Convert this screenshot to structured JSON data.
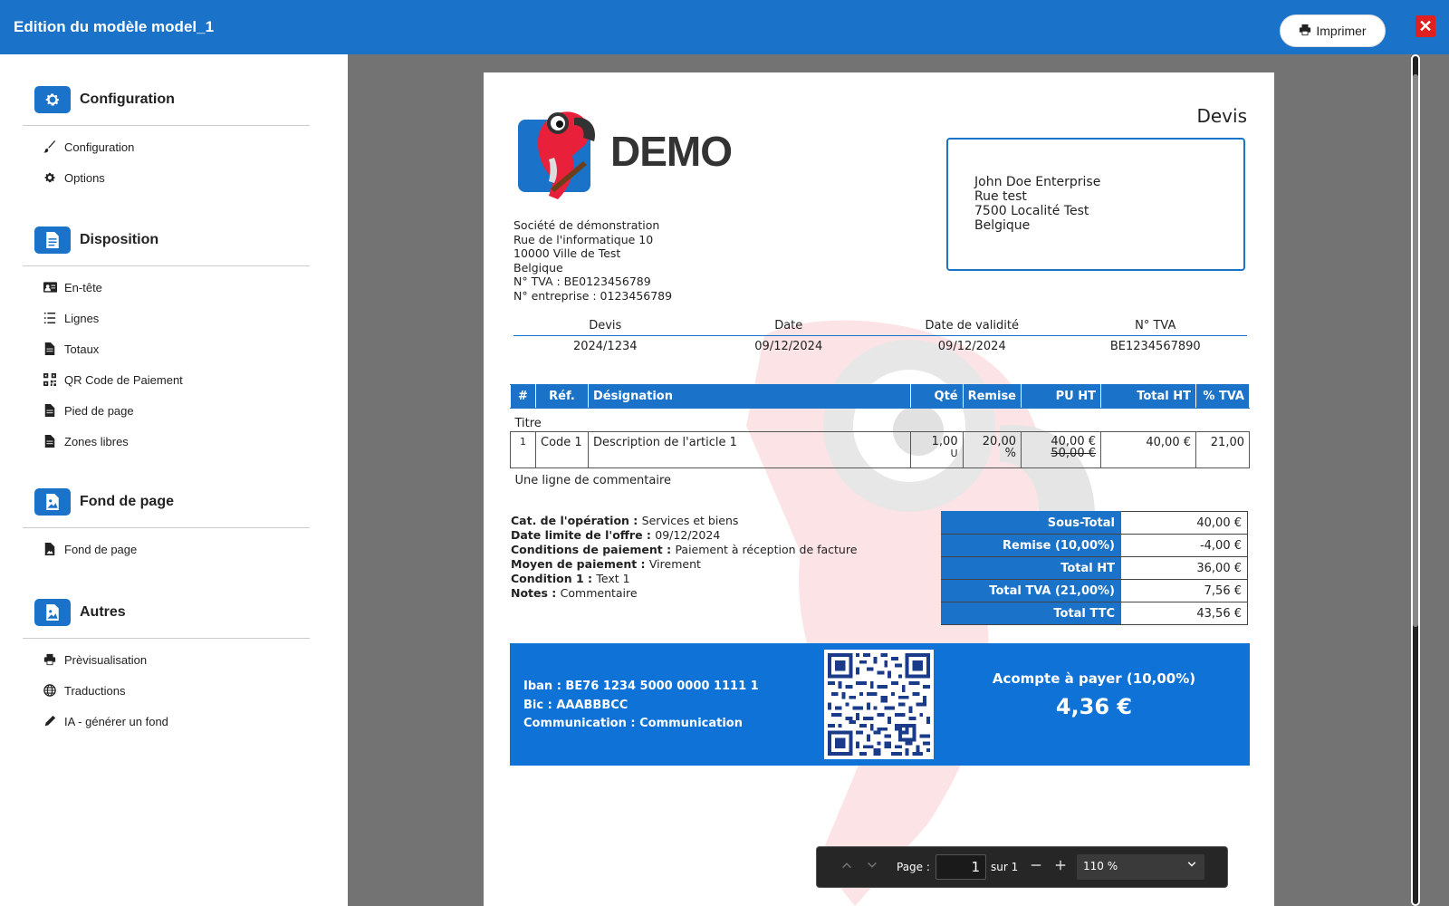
{
  "header": {
    "title": "Edition du modèle model_1",
    "print_label": "Imprimer",
    "close_label": "✕"
  },
  "sidebar": {
    "sections": [
      {
        "label": "Configuration",
        "icon": "gear-icon",
        "items": [
          {
            "label": "Configuration",
            "icon": "brush-icon"
          },
          {
            "label": "Options",
            "icon": "gear-icon"
          }
        ]
      },
      {
        "label": "Disposition",
        "icon": "document-icon",
        "items": [
          {
            "label": "En-tête",
            "icon": "id-card-icon"
          },
          {
            "label": "Lignes",
            "icon": "list-icon"
          },
          {
            "label": "Totaux",
            "icon": "file-icon"
          },
          {
            "label": "QR Code de Paiement",
            "icon": "qrcode-icon"
          },
          {
            "label": "Pied de page",
            "icon": "file-icon"
          },
          {
            "label": "Zones libres",
            "icon": "file-icon"
          }
        ]
      },
      {
        "label": "Fond de page",
        "icon": "image-icon",
        "items": [
          {
            "label": "Fond de page",
            "icon": "file-image-icon"
          }
        ]
      },
      {
        "label": "Autres",
        "icon": "image-icon",
        "items": [
          {
            "label": "Prèvisualisation",
            "icon": "printer-icon"
          },
          {
            "label": "Traductions",
            "icon": "globe-icon"
          },
          {
            "label": "IA - générer un fond",
            "icon": "pencil-icon"
          }
        ]
      }
    ]
  },
  "document": {
    "brand": "DEMO",
    "doc_type": "Devis",
    "client": {
      "name": "John Doe Enterprise",
      "street": "Rue test",
      "city": "7500 Localité Test",
      "country": "Belgique"
    },
    "company": {
      "name": "Société de démonstration",
      "street": "Rue de l'informatique 10",
      "city": "10000 Ville de Test",
      "country": "Belgique",
      "vat": "N° TVA : BE0123456789",
      "enterprise": "N° entreprise : 0123456789"
    },
    "meta": {
      "headers": [
        "Devis",
        "Date",
        "Date de validité",
        "N° TVA"
      ],
      "values": [
        "2024/1234",
        "09/12/2024",
        "09/12/2024",
        "BE1234567890"
      ]
    },
    "lines": {
      "headers": [
        "#",
        "Réf.",
        "Désignation",
        "Qté",
        "Remise",
        "PU HT",
        "Total HT",
        "% TVA"
      ],
      "section_title": "Titre",
      "row": {
        "num": "1",
        "ref": "Code 1",
        "designation": "Description de l'article 1",
        "qty": "1,00",
        "unit": "U",
        "discount": "20,00",
        "discount_unit": "%",
        "pu_new": "40,00 €",
        "pu_old": "50,00 €",
        "total": "40,00 €",
        "vat": "21,00"
      },
      "comment": "Une ligne de commentaire"
    },
    "conditions": [
      {
        "k": "Cat. de l'opération : ",
        "v": "Services et biens"
      },
      {
        "k": "Date limite de l'offre : ",
        "v": "09/12/2024"
      },
      {
        "k": "Conditions de paiement : ",
        "v": "Paiement à réception de facture"
      },
      {
        "k": "Moyen de paiement : ",
        "v": "Virement"
      },
      {
        "k": "Condition 1 : ",
        "v": "Text 1"
      },
      {
        "k": "Notes : ",
        "v": "Commentaire"
      }
    ],
    "totals": [
      {
        "label": "Sous-Total",
        "value": "40,00 €"
      },
      {
        "label": "Remise (10,00%)",
        "value": "-4,00 €"
      },
      {
        "label": "Total HT",
        "value": "36,00 €"
      },
      {
        "label": "Total TVA (21,00%)",
        "value": "7,56 €"
      },
      {
        "label": "Total TTC",
        "value": "43,56 €"
      }
    ],
    "payment": {
      "iban": "Iban : BE76 1234 5000 0000 1111 1",
      "bic": "Bic : AAABBBCC",
      "communication": "Communication : Communication",
      "deposit_label": "Acompte à payer (10,00%)",
      "deposit_value": "4,36 €"
    }
  },
  "pdf_toolbar": {
    "page_label": "Page :",
    "page_value": "1",
    "of_label": "sur 1",
    "zoom_value": "110 %"
  },
  "colors": {
    "accent": "#1a73c9",
    "band": "#0e72d6",
    "viewer_bg": "#737373",
    "close": "#e02020"
  }
}
